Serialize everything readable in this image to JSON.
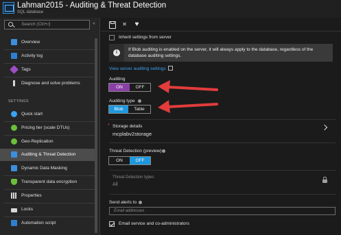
{
  "header": {
    "title": "Lahman2015 - Auditing & Threat Detection",
    "subtitle": "SQL database"
  },
  "sidebar": {
    "search_placeholder": "Search (Ctrl+/)",
    "collapse_glyph": "«",
    "section_settings": "SETTINGS",
    "items": [
      {
        "label": "Overview",
        "icon": "overview-icon",
        "color": "#3c8fdc"
      },
      {
        "label": "Activity log",
        "icon": "activity-log-icon",
        "color": "#2f7fd0"
      },
      {
        "label": "Tags",
        "icon": "tag-icon",
        "color": "#9c4fc4"
      },
      {
        "label": "Diagnose and solve problems",
        "icon": "wrench-icon",
        "color": "#d8d8d8"
      },
      {
        "label": "Quick start",
        "icon": "cloud-icon",
        "color": "#3ba2f2"
      },
      {
        "label": "Pricing tier (scale DTUs)",
        "icon": "gauge-icon",
        "color": "#6cbf3a"
      },
      {
        "label": "Geo-Replication",
        "icon": "globe-icon",
        "color": "#6cbf3a"
      },
      {
        "label": "Auditing & Threat Detection",
        "icon": "auditing-icon",
        "color": "#3c8fdc"
      },
      {
        "label": "Dynamic Data Masking",
        "icon": "masking-icon",
        "color": "#3c8fdc"
      },
      {
        "label": "Transparent data encryption",
        "icon": "shield-icon",
        "color": "#6cbf3a"
      },
      {
        "label": "Properties",
        "icon": "properties-icon",
        "color": "#d8d8d8"
      },
      {
        "label": "Locks",
        "icon": "lock-icon",
        "color": "#d8d8d8"
      },
      {
        "label": "Automation script",
        "icon": "script-icon",
        "color": "#2f7fd0"
      }
    ],
    "active_item": "Auditing & Threat Detection"
  },
  "toolbar": {
    "save_icon": "save-icon",
    "discard_icon": "discard-icon",
    "favorite_icon": "heart-icon"
  },
  "main": {
    "inherit_label": "Inherit settings from server",
    "inherit_checked": false,
    "info_text": "If Blob auditing is enabled on the server, it will always apply to the database, regardless of the database auditing settings.",
    "view_server_link": "View server auditing settings",
    "auditing": {
      "label": "Auditing",
      "options": [
        "ON",
        "OFF"
      ],
      "selected": "ON"
    },
    "auditing_type": {
      "label": "Auditing type",
      "options": [
        "Blob",
        "Table"
      ],
      "selected": "Blob"
    },
    "storage": {
      "label": "Storage details",
      "value": "mcplabv2storage",
      "required_marker": "*"
    },
    "threat_detection": {
      "label": "Threat Detection (preview)",
      "options": [
        "ON",
        "OFF"
      ],
      "selected": "OFF"
    },
    "threat_types": {
      "label": "Threat Detection types",
      "value": "All"
    },
    "send_alerts": {
      "label": "Send alerts to",
      "placeholder": "Email addresses"
    },
    "email_admins": {
      "label": "Email service and co-administrators",
      "checked": true
    }
  },
  "colors": {
    "accent_purple": "#8a3fa5",
    "accent_blue": "#1e97dd",
    "annotation_red": "#e23c3c",
    "link_blue": "#3ba2f2"
  }
}
